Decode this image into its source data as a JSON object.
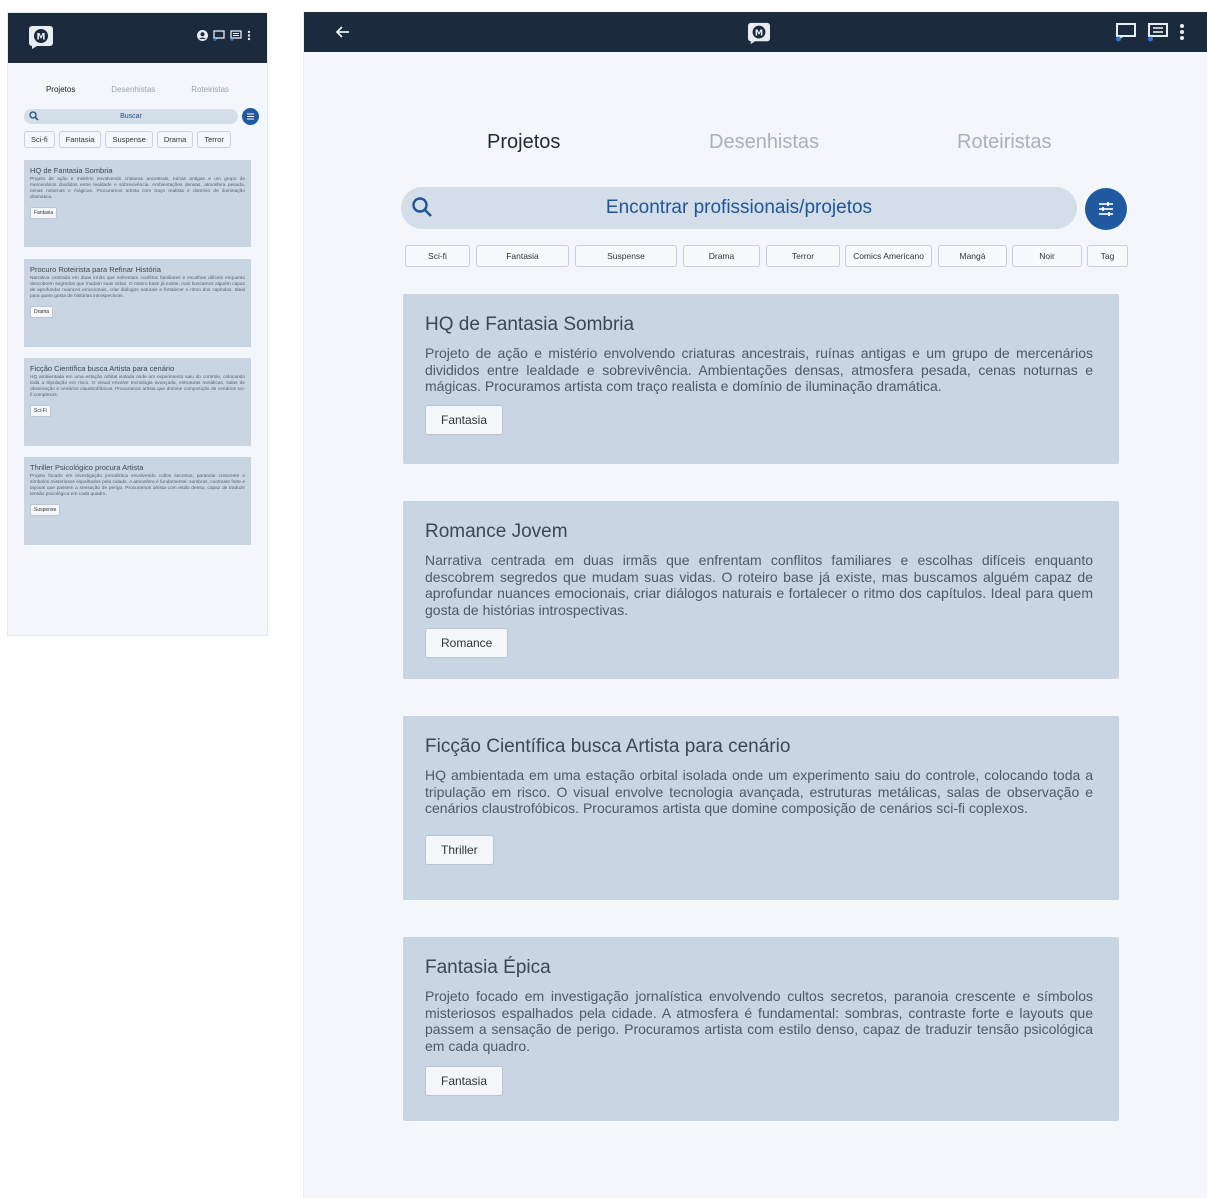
{
  "phone": {
    "tabs": [
      "Projetos",
      "Desenhistas",
      "Roteiristas"
    ],
    "search_placeholder": "Buscar",
    "chips": [
      "Sci-fi",
      "Fantasia",
      "Suspense",
      "Drama",
      "Terror"
    ],
    "cards": [
      {
        "title": "HQ de Fantasia Sombria",
        "description": "Projeto de ação e mistério envolvendo criaturas ancestrais, ruínas antigas e um grupo de mercenários divididos entre lealdade e sobrevivência. Ambientações densas, atmosfera pesada, cenas noturnas e mágicas. Procuramos artista com traço realista e domínio de iluminação dramática.",
        "tag": "Fantasia"
      },
      {
        "title": "Procuro Roteirista para Refinar História",
        "description": "Narrativa centrada em duas irmãs que enfrentam conflitos familiares e escolhas difíceis enquanto descobrem segredos que mudam suas vidas. O roteiro base já existe, mas buscamos alguém capaz de aprofundar nuances emocionais, criar diálogos naturais e fortalecer o ritmo dos capítulos. Ideal para quem gosta de histórias introspectivas.",
        "tag": "Drama"
      },
      {
        "title": "Ficção Científica busca Artista para cenário",
        "description": "HQ ambientada em uma estação orbital isolada onde um experimento saiu do controle, colocando toda a tripulação em risco. O visual envolve tecnologia avançada, estruturas metálicas, salas de observação e cenários claustrofóbicos. Procuramos artista que domine composição de cenários sci-fi complexos.",
        "tag": "Sci-Fi"
      },
      {
        "title": "Thriller Psicológico procura Artista",
        "description": "Projeto focado em investigação jornalística envolvendo cultos secretos, paranoia crescente e símbolos misteriosos espalhados pela cidade. A atmosfera é fundamental: sombras, contraste forte e layouts que passem a sensação de perigo. Procuramos artista com estilo denso, capaz de traduzir tensão psicológica em cada quadro.",
        "tag": "Suspense"
      }
    ]
  },
  "main": {
    "tabs": [
      "Projetos",
      "Desenhistas",
      "Roteiristas"
    ],
    "search_placeholder": "Encontrar profissionais/projetos",
    "chips": [
      "Sci-fi",
      "Fantasia",
      "Suspense",
      "Drama",
      "Terror",
      "Comics Americano",
      "Mangá",
      "Noir",
      "Tag"
    ],
    "cards": [
      {
        "title": "HQ de Fantasia Sombria",
        "description": "Projeto de ação e mistério envolvendo criaturas ancestrais, ruínas antigas e um grupo de mercenários divididos entre lealdade e sobrevivência. Ambientações densas, atmosfera pesada, cenas noturnas e mágicas. Procuramos artista com traço realista e domínio de iluminação dramática.",
        "tag": "Fantasia"
      },
      {
        "title": "Romance Jovem",
        "description": "Narrativa centrada em duas irmãs que enfrentam conflitos familiares e escolhas difíceis enquanto descobrem segredos que mudam suas vidas. O roteiro base já existe, mas buscamos alguém capaz de aprofundar nuances emocionais, criar diálogos naturais e fortalecer o ritmo dos capítulos. Ideal para quem gosta de histórias introspectivas.",
        "tag": "Romance"
      },
      {
        "title": "Ficção Científica busca Artista para cenário",
        "description": "HQ ambientada em uma estação orbital isolada onde um experimento saiu do controle, colocando toda a tripulação em risco. O visual envolve tecnologia avançada, estruturas metálicas, salas de observação e cenários claustrofóbicos. Procuramos artista que domine composição de cenários sci-fi coplexos.",
        "tag": "Thriller"
      },
      {
        "title": "Fantasia Épica",
        "description": "Projeto focado em investigação jornalística envolvendo cultos secretos, paranoia crescente e símbolos misteriosos espalhados pela cidade. A atmosfera é fundamental: sombras, contraste forte e layouts que passem a sensação de perigo. Procuramos artista com estilo denso, capaz de traduzir tensão psicológica em cada quadro.",
        "tag": "Fantasia"
      }
    ]
  },
  "colors": {
    "appbar": "#1b2a3c",
    "accent": "#1f5aa0",
    "card": "#c8d5e3",
    "search": "#d3dee9",
    "background": "#f3f6fa"
  },
  "icons": {
    "logo": "comic-speech-logo-icon",
    "back": "arrow-back-icon",
    "profile": "profile-icon",
    "chat": "chat-icon",
    "messages": "messages-icon",
    "more": "more-vert-icon",
    "search": "search-icon",
    "filter": "filter-sliders-icon"
  }
}
